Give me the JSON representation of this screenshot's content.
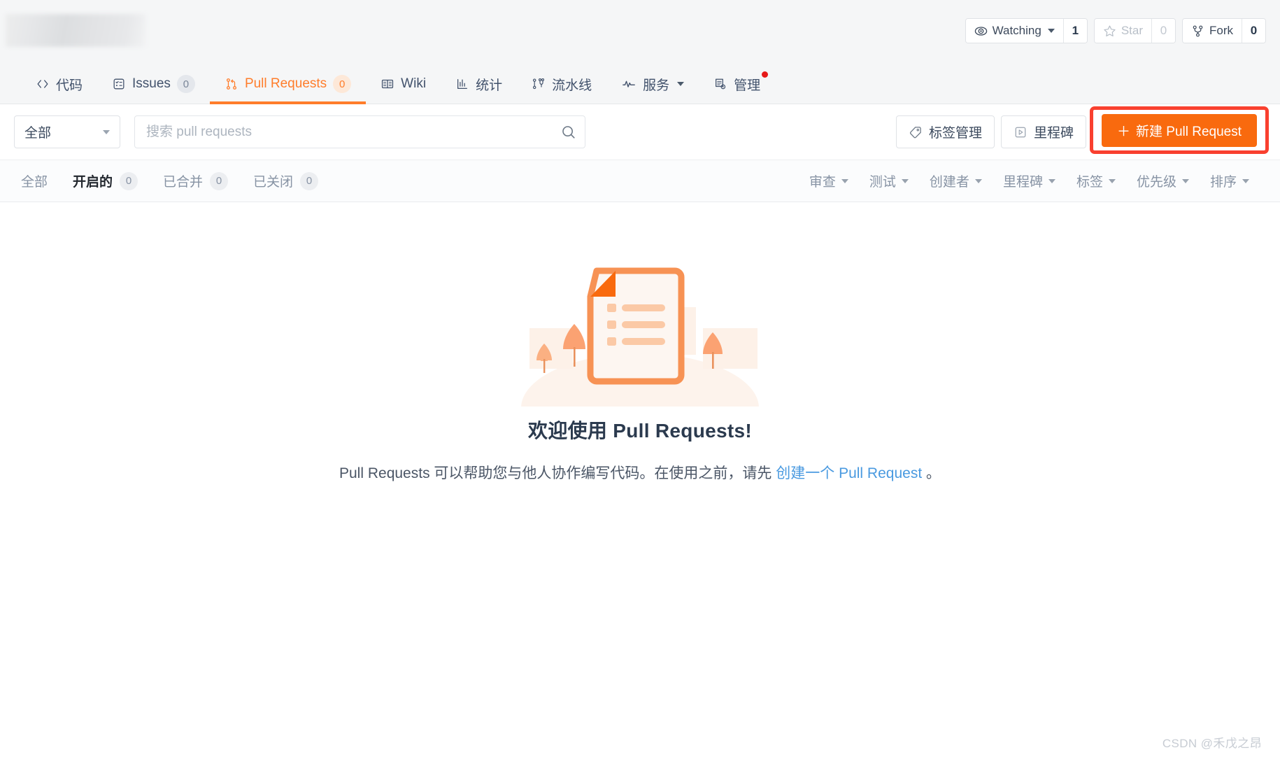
{
  "header": {
    "repo_logo": "redacted-repo-logo",
    "actions": [
      {
        "icon": "eye-icon",
        "label": "Watching",
        "has_caret": true,
        "count": "1",
        "dim": false
      },
      {
        "icon": "star-icon",
        "label": "Star",
        "has_caret": false,
        "count": "0",
        "dim": true
      },
      {
        "icon": "fork-icon",
        "label": "Fork",
        "has_caret": false,
        "count": "0",
        "dim": false
      }
    ]
  },
  "nav": {
    "tabs": [
      {
        "icon": "code-icon",
        "label": "代码",
        "count": null,
        "active": false,
        "caret": false,
        "dot": false
      },
      {
        "icon": "issues-icon",
        "label": "Issues",
        "count": "0",
        "active": false,
        "caret": false,
        "dot": false
      },
      {
        "icon": "pull-request-icon",
        "label": "Pull Requests",
        "count": "0",
        "active": true,
        "caret": false,
        "dot": false
      },
      {
        "icon": "wiki-icon",
        "label": "Wiki",
        "count": null,
        "active": false,
        "caret": false,
        "dot": false
      },
      {
        "icon": "stats-icon",
        "label": "统计",
        "count": null,
        "active": false,
        "caret": false,
        "dot": false
      },
      {
        "icon": "pipeline-icon",
        "label": "流水线",
        "count": null,
        "active": false,
        "caret": false,
        "dot": false
      },
      {
        "icon": "service-icon",
        "label": "服务",
        "count": null,
        "active": false,
        "caret": true,
        "dot": false
      },
      {
        "icon": "manage-icon",
        "label": "管理",
        "count": null,
        "active": false,
        "caret": false,
        "dot": true
      }
    ]
  },
  "toolbar": {
    "scope_label": "全部",
    "search_placeholder": "搜索 pull requests",
    "search_value": "",
    "search_icon": "search-icon",
    "label_manage": "标签管理",
    "label_manage_icon": "tag-icon",
    "milestone": "里程碑",
    "milestone_icon": "milestone-icon",
    "new_pr": "新建 Pull Request",
    "new_pr_plus": "＋"
  },
  "filters": {
    "state_tabs": [
      {
        "label": "全部",
        "count": null,
        "active": false
      },
      {
        "label": "开启的",
        "count": "0",
        "active": true
      },
      {
        "label": "已合并",
        "count": "0",
        "active": false
      },
      {
        "label": "已关闭",
        "count": "0",
        "active": false
      }
    ],
    "dropdowns": [
      {
        "label": "审查"
      },
      {
        "label": "测试"
      },
      {
        "label": "创建者"
      },
      {
        "label": "里程碑"
      },
      {
        "label": "标签"
      },
      {
        "label": "优先级"
      },
      {
        "label": "排序"
      }
    ]
  },
  "empty_state": {
    "illustration": "document-with-trees-illustration",
    "title": "欢迎使用 Pull Requests!",
    "desc_before": "Pull Requests 可以帮助您与他人协作编写代码。在使用之前，请先 ",
    "desc_link": "创建一个 Pull Request",
    "desc_after": " 。"
  },
  "watermark": "CSDN @禾戊之昂",
  "colors": {
    "accent_orange": "#ff7d2b",
    "primary_button": "#f96a0e",
    "highlight_red": "#f9402f",
    "link_blue": "#4a9ae0",
    "text_dark": "#2b3a4e",
    "text_muted": "#8793a4",
    "notification_dot": "#e61919"
  }
}
